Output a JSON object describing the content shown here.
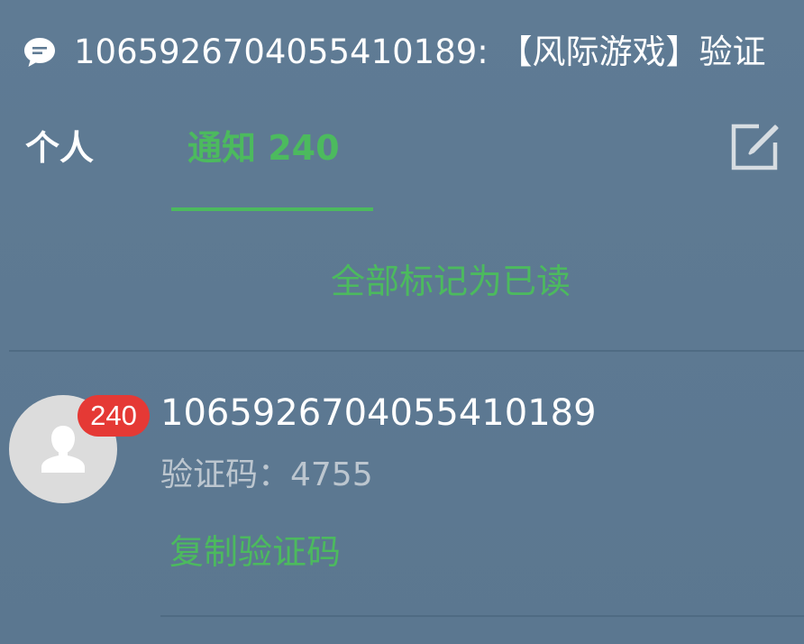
{
  "notification": {
    "icon": "chat-bubble-icon",
    "text": "10659267040554101​89: 【风际游戏】验证"
  },
  "tabs": [
    {
      "label": "个人"
    },
    {
      "label": "通知 240"
    }
  ],
  "compose_icon": "edit-square-icon",
  "mark_all_read": "全部标记为已读",
  "messages": [
    {
      "sender": "1065926704055410189",
      "preview": "验证码：4755",
      "badge": "240",
      "action": "复制验证码",
      "avatar_icon": "person-icon"
    }
  ],
  "colors": {
    "accent": "#4cba5e",
    "badge": "#e53935",
    "background": "#5e7a93"
  }
}
